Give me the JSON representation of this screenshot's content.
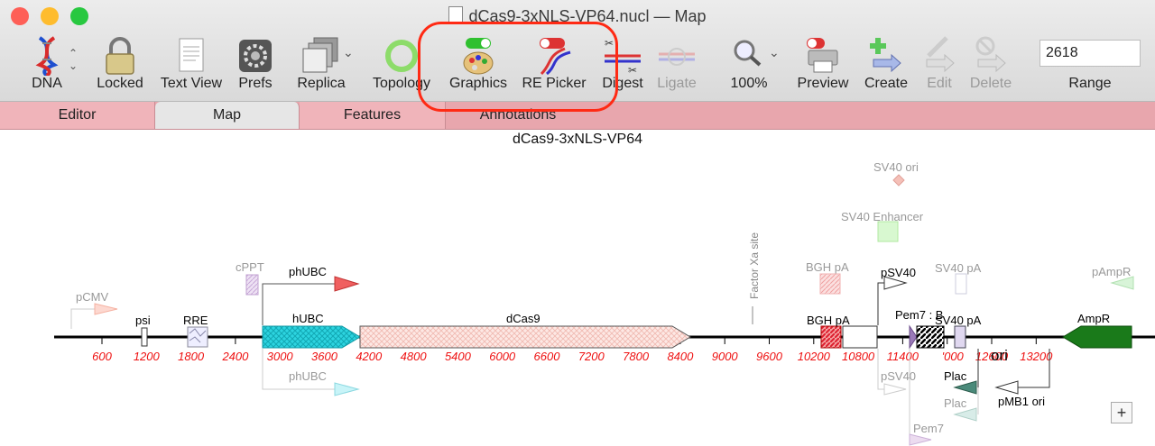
{
  "window": {
    "title": "dCas9-3xNLS-VP64.nucl — Map",
    "traffic_colors": [
      "#fe5f57",
      "#febc2e",
      "#28c840"
    ]
  },
  "toolbar": {
    "items": [
      {
        "label": "DNA",
        "icon": "dna-helix-icon",
        "enabled": true
      },
      {
        "label": "Locked",
        "icon": "lock-icon",
        "enabled": true
      },
      {
        "label": "Text View",
        "icon": "text-document-icon",
        "enabled": true
      },
      {
        "label": "Prefs",
        "icon": "gear-icon",
        "enabled": true
      },
      {
        "label": "Replica",
        "icon": "stacked-pages-icon",
        "enabled": true
      },
      {
        "label": "Topology",
        "icon": "circle-ring-icon",
        "enabled": true
      },
      {
        "label": "Graphics",
        "icon": "palette-toggle-icon",
        "enabled": true
      },
      {
        "label": "RE Picker",
        "icon": "dna-scissors-icon",
        "enabled": true
      },
      {
        "label": "Digest",
        "icon": "digest-scissors-icon",
        "enabled": true
      },
      {
        "label": "Ligate",
        "icon": "ligate-icon",
        "enabled": false
      },
      {
        "label": "100%",
        "icon": "magnifier-icon",
        "enabled": true
      },
      {
        "label": "Preview",
        "icon": "printer-icon",
        "enabled": true
      },
      {
        "label": "Create",
        "icon": "plus-arrow-icon",
        "enabled": true
      },
      {
        "label": "Edit",
        "icon": "pencil-arrow-icon",
        "enabled": false
      },
      {
        "label": "Delete",
        "icon": "no-entry-arrow-icon",
        "enabled": false
      }
    ],
    "range": {
      "value": "2618",
      "label": "Range"
    }
  },
  "tabs": [
    {
      "label": "Editor",
      "active": false
    },
    {
      "label": "Map",
      "active": true
    },
    {
      "label": "Features",
      "active": false
    },
    {
      "label": "Annotations",
      "active": false
    }
  ],
  "map": {
    "title": "dCas9-3xNLS-VP64",
    "ticks": [
      "600",
      "1200",
      "1800",
      "2400",
      "3000",
      "3600",
      "4200",
      "4800",
      "5400",
      "6000",
      "6600",
      "7200",
      "7800",
      "8400",
      "9000",
      "9600",
      "10200",
      "10800",
      "11400",
      "12000",
      "12600",
      "13200"
    ],
    "tick_partial": {
      "10800": "0800",
      "12000": "'000"
    },
    "features": {
      "pCMV": "pCMV",
      "psi": "psi",
      "RRE": "RRE",
      "cPPT": "cPPT",
      "phUBC_top": "phUBC",
      "hUBC": "hUBC",
      "phUBC_bottom": "phUBC",
      "dCas9": "dCas9",
      "Factor Xa site": "Factor Xa site",
      "BGH pA top": "BGH pA",
      "BGH pA": "BGH pA",
      "SV40 ori": "SV40 ori",
      "SV40 Enhancer": "SV40 Enhancer",
      "pSV40 top": "pSV40",
      "pSV40 bottom": "pSV40",
      "SV40 pA top": "SV40 pA",
      "SV40 pA": "SV40 pA",
      "Pem7 top": "Pem7 : B",
      "Pem7 bottom": "Pem7",
      "Plac": "Plac",
      "Plac2": "Plac",
      "ori": "ori",
      "pMB1 ori": "pMB1 ori",
      "pAmpR": "pAmpR",
      "AmpR": "AmpR"
    },
    "zoom_button": "+"
  },
  "colors": {
    "tick_label": "#ee1111",
    "tab_bar": "#e8a6ad",
    "highlight": "#ff2a14",
    "phUBC": "#f06060",
    "hUBC": "#2dd4e0",
    "dCas9": "#fde0dc",
    "BGH": "#dd1f2f",
    "AmpR": "#1a7a1a",
    "Plac": "#4a8a7a"
  }
}
